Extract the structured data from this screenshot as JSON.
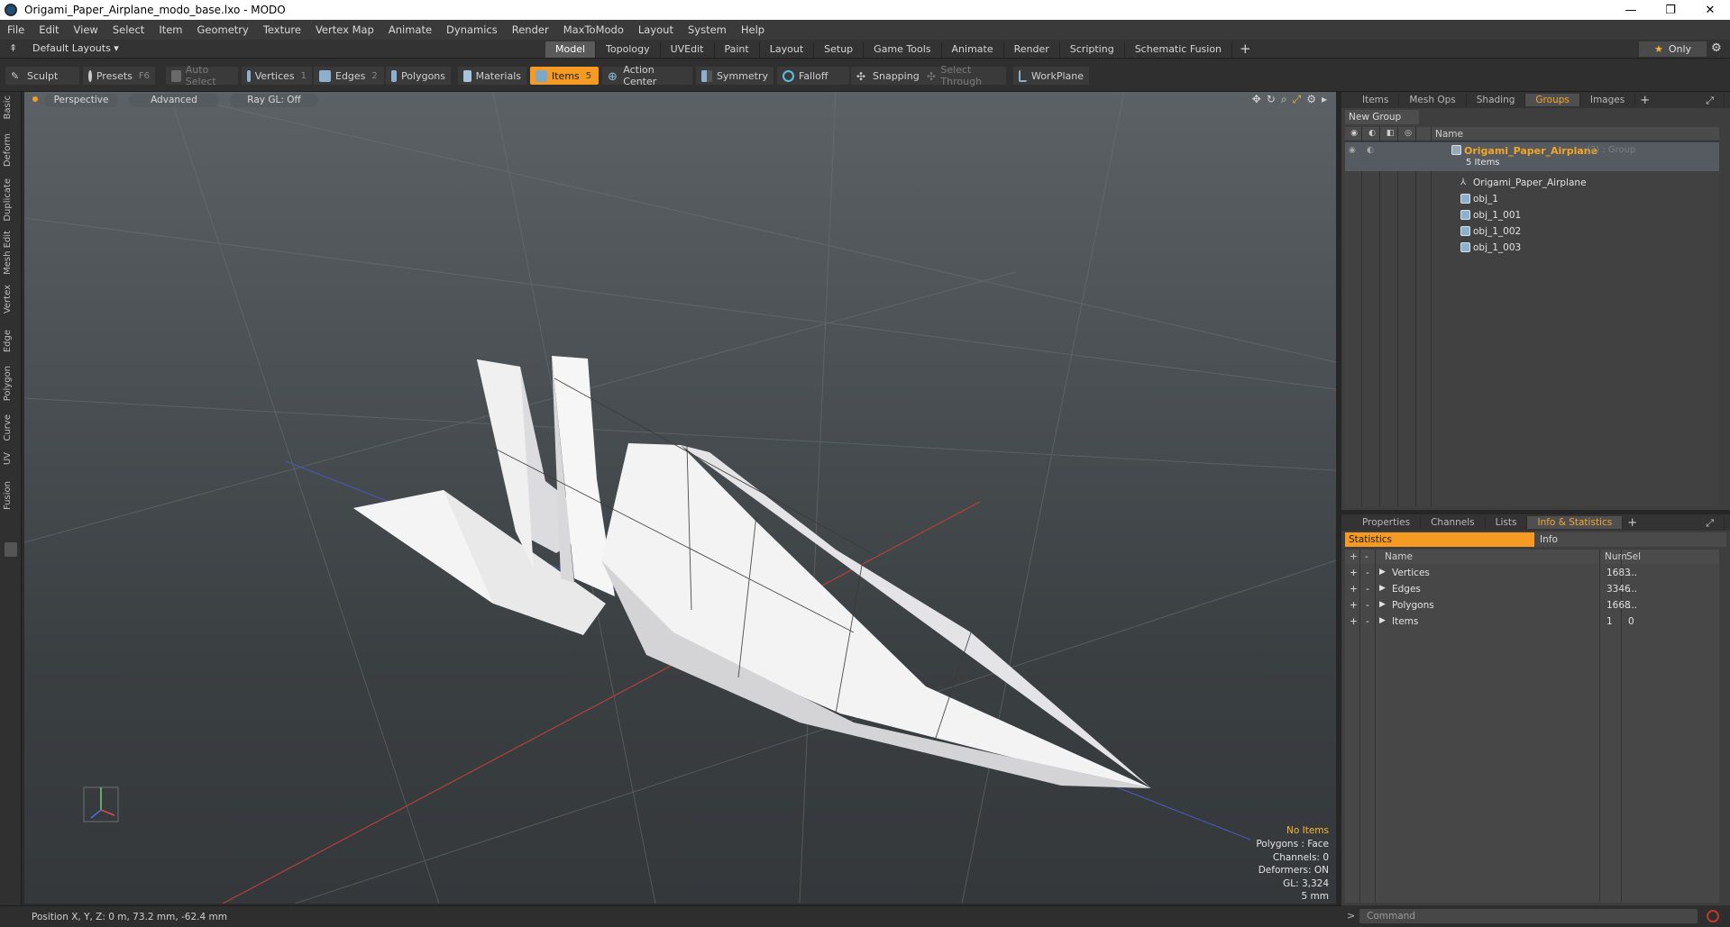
{
  "window": {
    "title": "Origami_Paper_Airplane_modo_base.lxo - MODO",
    "minimize": "—",
    "maximize": "❐",
    "close": "✕"
  },
  "menu": [
    "File",
    "Edit",
    "View",
    "Select",
    "Item",
    "Geometry",
    "Texture",
    "Vertex Map",
    "Animate",
    "Dynamics",
    "Render",
    "MaxToModo",
    "Layout",
    "System",
    "Help"
  ],
  "layoutbar": {
    "layouts_label": "Default Layouts ▾",
    "tabs": [
      "Model",
      "Topology",
      "UVEdit",
      "Paint",
      "Layout",
      "Setup",
      "Game Tools",
      "Animate",
      "Render",
      "Scripting",
      "Schematic Fusion"
    ],
    "active_tab": "Model",
    "add_tab": "+",
    "only_label": "Only"
  },
  "toolbar": {
    "sculpt": "Sculpt",
    "presets": "Presets",
    "presets_key": "F6",
    "auto_select": "Auto Select",
    "vertices": "Vertices",
    "vertices_key": "1",
    "edges": "Edges",
    "edges_key": "2",
    "polygons": "Polygons",
    "materials": "Materials",
    "items": "Items",
    "items_key": "5",
    "action_center": "Action Center",
    "symmetry": "Symmetry",
    "falloff": "Falloff",
    "snapping": "Snapping",
    "select_through": "Select Through",
    "workplane": "WorkPlane"
  },
  "left_tabs": [
    "Basic",
    "Deform",
    "Duplicate",
    "Mesh Edit",
    "Vertex",
    "Edge",
    "Polygon",
    "Curve",
    "UV",
    "Fusion"
  ],
  "viewport": {
    "view": "Perspective",
    "shading": "Advanced",
    "raygl": "Ray GL: Off",
    "info": {
      "selection": "No Items",
      "polygons": "Polygons : Face",
      "channels": "Channels: 0",
      "deformers": "Deformers: ON",
      "gl": "GL: 3,324",
      "scale": "5 mm"
    }
  },
  "status": {
    "position": "Position X, Y, Z:  0 m, 73.2 mm, -62.4 mm"
  },
  "groups_panel": {
    "tabs": [
      "Items",
      "Mesh Ops",
      "Shading",
      "Groups",
      "Images"
    ],
    "active_tab": "Groups",
    "new_group": "New Group",
    "col_name": "Name",
    "group": {
      "name": "Origami_Paper_Airplane",
      "meta": "(2) : Group",
      "count": "5 Items"
    },
    "children": [
      "Origami_Paper_Airplane",
      "obj_1",
      "obj_1_001",
      "obj_1_002",
      "obj_1_003"
    ]
  },
  "info_panel": {
    "tabs": [
      "Properties",
      "Channels",
      "Lists",
      "Info & Statistics"
    ],
    "active_tab": "Info & Statistics",
    "statistics": "Statistics",
    "info": "Info",
    "headers": {
      "name": "Name",
      "num": "Num",
      "sel": "Sel"
    },
    "rows": [
      {
        "name": "Vertices",
        "num": "1683",
        "sel": "..."
      },
      {
        "name": "Edges",
        "num": "3346",
        "sel": "..."
      },
      {
        "name": "Polygons",
        "num": "1668",
        "sel": "..."
      },
      {
        "name": "Items",
        "num": "1",
        "sel": "0"
      }
    ]
  },
  "command": {
    "placeholder": "Command"
  },
  "colors": {
    "accent": "#f59a23",
    "viewport_top": "#5b6165",
    "viewport_bottom": "#34383b"
  }
}
